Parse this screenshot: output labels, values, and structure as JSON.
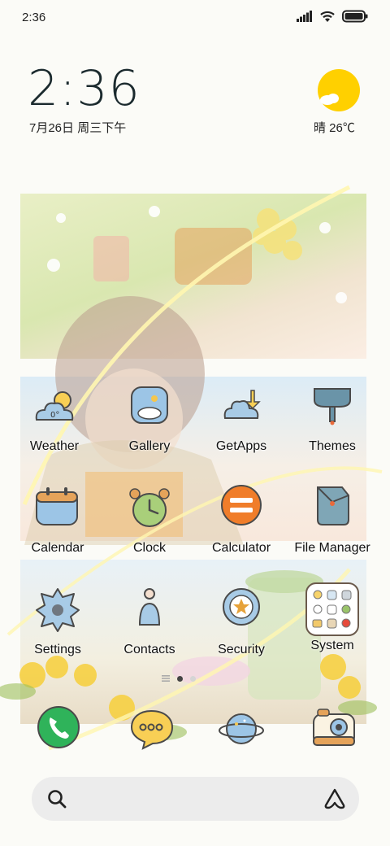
{
  "status_bar": {
    "time": "2:36"
  },
  "clock_widget": {
    "time": "2:36",
    "date": "7月26日 周三下午"
  },
  "weather_widget": {
    "condition_temp": "晴 26℃"
  },
  "apps": [
    {
      "label": "Weather",
      "icon": "weather-icon"
    },
    {
      "label": "Gallery",
      "icon": "gallery-icon"
    },
    {
      "label": "GetApps",
      "icon": "getapps-icon"
    },
    {
      "label": "Themes",
      "icon": "themes-icon"
    },
    {
      "label": "Calendar",
      "icon": "calendar-icon"
    },
    {
      "label": "Clock",
      "icon": "clock-icon"
    },
    {
      "label": "Calculator",
      "icon": "calculator-icon"
    },
    {
      "label": "File Manager",
      "icon": "file-manager-icon"
    },
    {
      "label": "Settings",
      "icon": "settings-icon"
    },
    {
      "label": "Contacts",
      "icon": "contacts-icon"
    },
    {
      "label": "Security",
      "icon": "security-icon"
    },
    {
      "label": "System",
      "icon": "system-folder-icon"
    }
  ],
  "weather_icon_text": "0°",
  "page_indicator": {
    "pages": 2,
    "active": 1
  },
  "dock": [
    "phone-icon",
    "messages-icon",
    "browser-icon",
    "camera-icon"
  ],
  "colors": {
    "accent_orange": "#f07d2a",
    "sun_yellow": "#ffd000",
    "phone_green": "#2fb35a"
  }
}
